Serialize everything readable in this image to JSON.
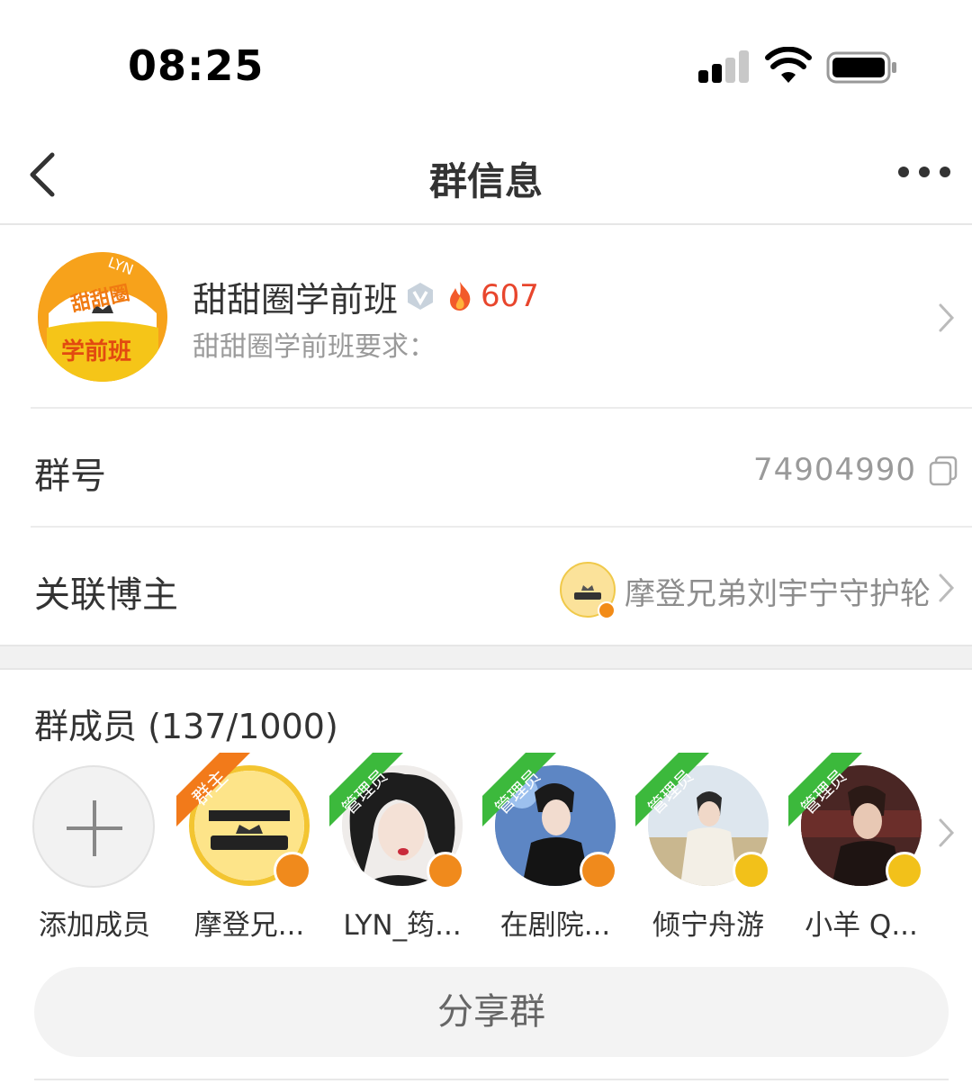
{
  "status_bar": {
    "time": "08:25"
  },
  "nav": {
    "title": "群信息"
  },
  "group": {
    "name": "甜甜圈学前班",
    "heat": "607",
    "description": "甜甜圈学前班要求：",
    "avatar_text_top": "甜甜圈",
    "avatar_text_bottom": "学前班",
    "avatar_text_arc": "LYN"
  },
  "group_id_row": {
    "label": "群号",
    "value": "74904990"
  },
  "blogger_row": {
    "label": "关联博主",
    "name": "摩登兄弟刘宇宁守护轮"
  },
  "members": {
    "title": "群成员 (137/1000)",
    "add_label": "添加成员",
    "list": [
      {
        "name": "摩登兄...",
        "role": "群主",
        "badge_color": "#f08a1c"
      },
      {
        "name": "LYN_筠...",
        "role": "管理员",
        "badge_color": "#f08a1c"
      },
      {
        "name": "在剧院...",
        "role": "管理员",
        "badge_color": "#f08a1c"
      },
      {
        "name": "倾宁舟游",
        "role": "管理员",
        "badge_color": "#f2c11a"
      },
      {
        "name": "小羊 Q...",
        "role": "管理员",
        "badge_color": "#f2c11a"
      }
    ]
  },
  "share": {
    "label": "分享群"
  },
  "colors": {
    "accent_orange": "#f08a1c",
    "heat_red": "#e8462d",
    "admin_green": "#3cb93c",
    "owner_orange": "#f27a1a"
  }
}
